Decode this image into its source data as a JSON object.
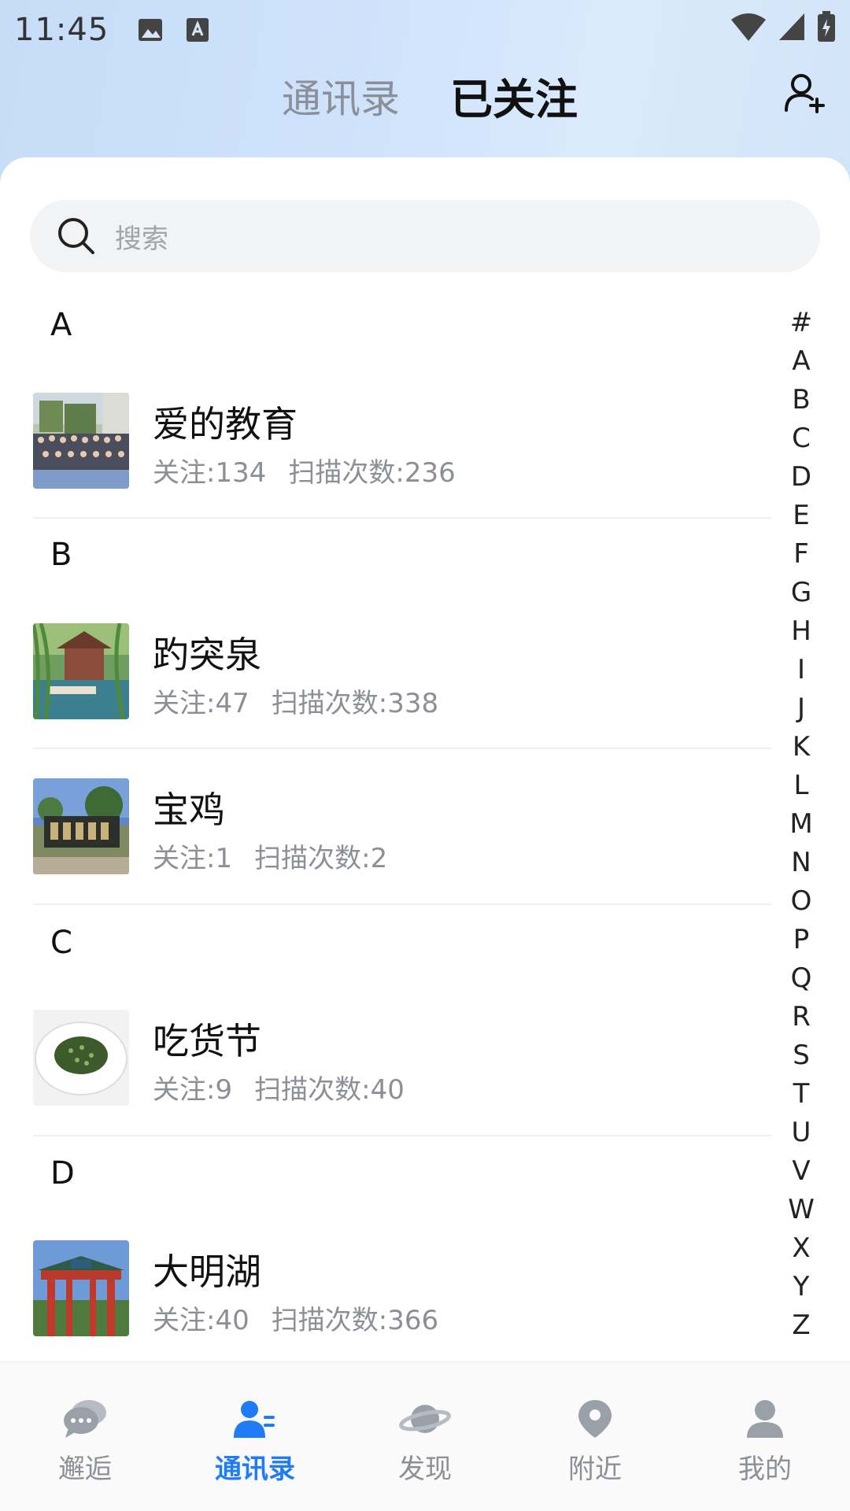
{
  "status_bar": {
    "time": "11:45"
  },
  "header": {
    "tab_contacts": "通讯录",
    "tab_followed": "已关注"
  },
  "search": {
    "placeholder": "搜索"
  },
  "sections": [
    {
      "letter": "A",
      "items": [
        {
          "title": "爱的教育",
          "follow_label": "关注:",
          "follows": "134",
          "scan_label": "扫描次数:",
          "scans": "236",
          "thumb": "group-photo"
        }
      ]
    },
    {
      "letter": "B",
      "items": [
        {
          "title": "趵突泉",
          "follow_label": "关注:",
          "follows": "47",
          "scan_label": "扫描次数:",
          "scans": "338",
          "thumb": "spring-pavilion"
        },
        {
          "title": "宝鸡",
          "follow_label": "关注:",
          "follows": "1",
          "scan_label": "扫描次数:",
          "scans": "2",
          "thumb": "stone-monument"
        }
      ]
    },
    {
      "letter": "C",
      "items": [
        {
          "title": "吃货节",
          "follow_label": "关注:",
          "follows": "9",
          "scan_label": "扫描次数:",
          "scans": "40",
          "thumb": "dish-plate"
        }
      ]
    },
    {
      "letter": "D",
      "items": [
        {
          "title": "大明湖",
          "follow_label": "关注:",
          "follows": "40",
          "scan_label": "扫描次数:",
          "scans": "366",
          "thumb": "red-gate"
        }
      ]
    }
  ],
  "index_letters": [
    "#",
    "A",
    "B",
    "C",
    "D",
    "E",
    "F",
    "G",
    "H",
    "I",
    "J",
    "K",
    "L",
    "M",
    "N",
    "O",
    "P",
    "Q",
    "R",
    "S",
    "T",
    "U",
    "V",
    "W",
    "X",
    "Y",
    "Z"
  ],
  "bottom_nav": [
    {
      "label": "邂逅",
      "icon": "chat-bubble-icon",
      "active": false
    },
    {
      "label": "通讯录",
      "icon": "contacts-icon",
      "active": true
    },
    {
      "label": "发现",
      "icon": "planet-icon",
      "active": false
    },
    {
      "label": "附近",
      "icon": "location-pin-icon",
      "active": false
    },
    {
      "label": "我的",
      "icon": "profile-icon",
      "active": false
    }
  ],
  "colors": {
    "accent": "#1f7cf6",
    "muted": "#8c9096"
  }
}
